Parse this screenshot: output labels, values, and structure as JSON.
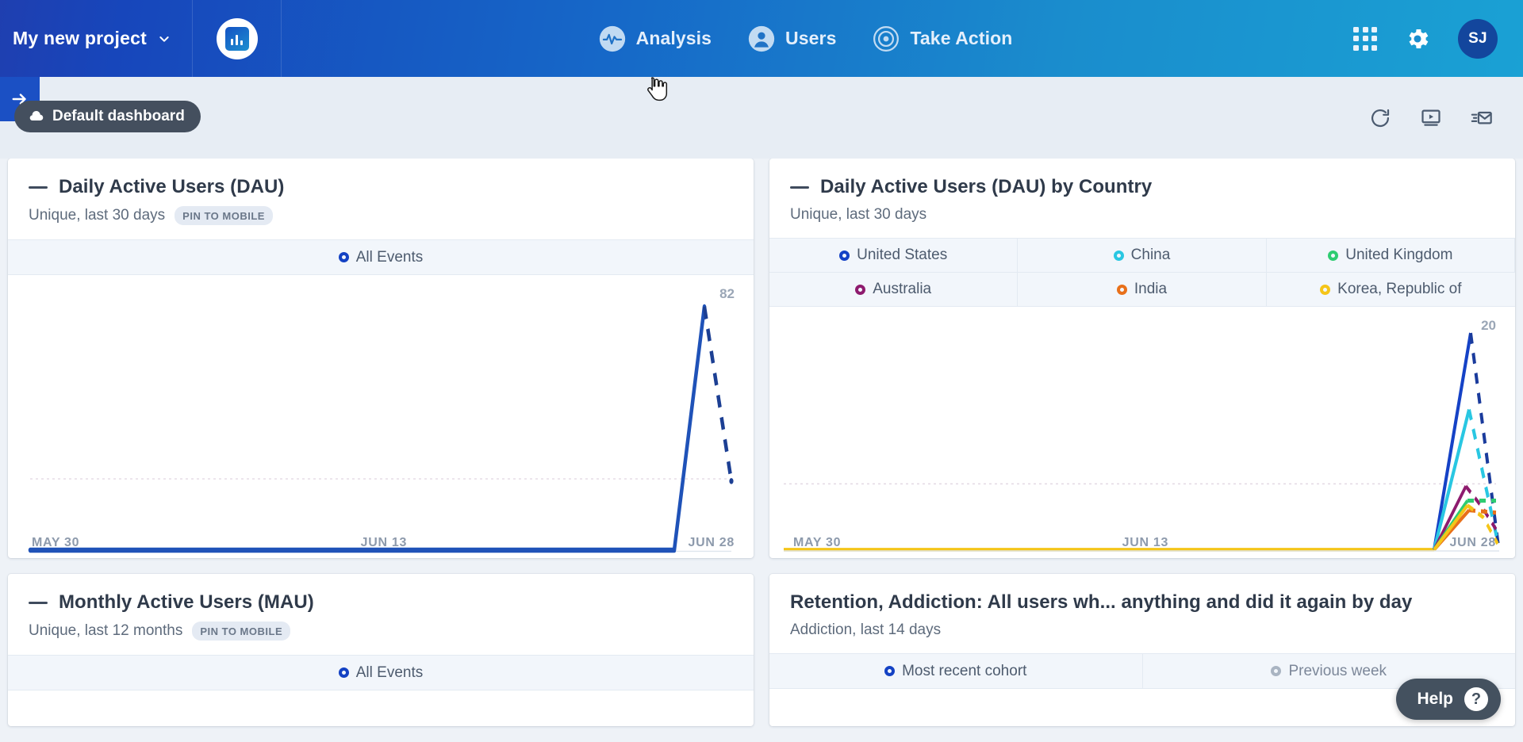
{
  "topnav": {
    "project_name": "My new project",
    "project_chevron_icon": "chevron-down-icon",
    "logo_icon": "bar-chart-logo-icon",
    "items": [
      {
        "label": "Analysis",
        "icon": "analysis-pulse-icon"
      },
      {
        "label": "Users",
        "icon": "user-circle-icon"
      },
      {
        "label": "Take Action",
        "icon": "target-icon"
      }
    ],
    "apps_icon": "apps-grid-icon",
    "settings_icon": "gear-icon",
    "avatar_initials": "SJ",
    "colors": {
      "gradient_start": "#1f3fb0",
      "gradient_end": "#1aa1d4",
      "avatar_bg": "#13469d"
    }
  },
  "subbar": {
    "sidebar_toggle_icon": "arrow-right-icon",
    "dashboard_label": "Default dashboard",
    "dashboard_icon": "cloud-upload-icon",
    "actions": [
      {
        "name": "refresh",
        "icon": "refresh-icon"
      },
      {
        "name": "present",
        "icon": "present-play-icon"
      },
      {
        "name": "email",
        "icon": "email-send-icon"
      }
    ],
    "colors": {
      "toggle_bg": "#1b50c4",
      "pill_bg": "#444f5e",
      "bar_bg": "#e7edf4"
    }
  },
  "cards": [
    {
      "title": "Daily Active Users (DAU)",
      "subtitle": "Unique, last 30 days",
      "pin_badge": "PIN TO MOBILE",
      "has_dash_mark": true,
      "legend": [
        {
          "label": "All Events",
          "color": "#1442c4"
        }
      ]
    },
    {
      "title": "Daily Active Users (DAU) by Country",
      "subtitle": "Unique, last 30 days",
      "pin_badge": "",
      "has_dash_mark": true,
      "legend": [
        {
          "label": "United States",
          "color": "#1542c6"
        },
        {
          "label": "China",
          "color": "#29c7e2"
        },
        {
          "label": "United Kingdom",
          "color": "#2ecc71"
        },
        {
          "label": "Australia",
          "color": "#8e1b6e"
        },
        {
          "label": "India",
          "color": "#e8701a"
        },
        {
          "label": "Korea, Republic of",
          "color": "#f5c518"
        }
      ]
    },
    {
      "title": "Monthly Active Users (MAU)",
      "subtitle": "Unique, last 12 months",
      "pin_badge": "PIN TO MOBILE",
      "has_dash_mark": true,
      "legend": [
        {
          "label": "All Events",
          "color": "#1442c4"
        }
      ]
    },
    {
      "title": "Retention, Addiction: All users wh... anything and did it again by day",
      "subtitle": "Addiction, last 14 days",
      "pin_badge": "",
      "has_dash_mark": false,
      "legend": [
        {
          "label": "Most recent cohort",
          "color": "#1442c4"
        },
        {
          "label": "Previous week",
          "color": "#a9b4c2"
        }
      ]
    }
  ],
  "chart_data": [
    {
      "id": "dau",
      "type": "line",
      "title": "Daily Active Users (DAU)",
      "xlabel": "",
      "ylabel": "",
      "ymax_label": "82",
      "ylim": [
        0,
        82
      ],
      "grid": false,
      "dashed_tail": true,
      "legend_position": "top",
      "xtick_labels": [
        "MAY 30",
        "JUN 13",
        "JUN 28"
      ],
      "series": [
        {
          "name": "All Events",
          "color": "#1442c4",
          "x": [
            "MAY 30",
            "JUN 1",
            "JUN 3",
            "JUN 5",
            "JUN 7",
            "JUN 9",
            "JUN 11",
            "JUN 13",
            "JUN 15",
            "JUN 17",
            "JUN 19",
            "JUN 21",
            "JUN 23",
            "JUN 25",
            "JUN 26",
            "JUN 27",
            "JUN 28"
          ],
          "values": [
            0,
            0,
            0,
            0,
            0,
            0,
            0,
            0,
            0,
            0,
            0,
            0,
            0,
            0,
            0,
            82,
            24
          ]
        }
      ]
    },
    {
      "id": "dau_by_country",
      "type": "line",
      "title": "Daily Active Users (DAU) by Country",
      "xlabel": "",
      "ylabel": "",
      "ymax_label": "20",
      "ylim": [
        0,
        20
      ],
      "grid": false,
      "dashed_tail": true,
      "legend_position": "top",
      "xtick_labels": [
        "MAY 30",
        "JUN 13",
        "JUN 28"
      ],
      "series": [
        {
          "name": "United States",
          "color": "#1542c6",
          "values": [
            0,
            0,
            0,
            0,
            0,
            0,
            0,
            0,
            0,
            0,
            0,
            0,
            0,
            0,
            0,
            20,
            0
          ]
        },
        {
          "name": "China",
          "color": "#29c7e2",
          "values": [
            0,
            0,
            0,
            0,
            0,
            0,
            0,
            0,
            0,
            0,
            0,
            0,
            0,
            0,
            0,
            13,
            1
          ]
        },
        {
          "name": "United Kingdom",
          "color": "#2ecc71",
          "values": [
            0,
            0,
            0,
            0,
            0,
            0,
            0,
            0,
            0,
            0,
            0,
            0,
            0,
            0,
            0,
            4,
            4
          ]
        },
        {
          "name": "Australia",
          "color": "#8e1b6e",
          "values": [
            0,
            0,
            0,
            0,
            0,
            0,
            0,
            0,
            0,
            0,
            0,
            0,
            0,
            0,
            0,
            5,
            2
          ]
        },
        {
          "name": "India",
          "color": "#e8701a",
          "values": [
            0,
            0,
            0,
            0,
            0,
            0,
            0,
            0,
            0,
            0,
            0,
            0,
            0,
            0,
            0,
            3,
            3
          ]
        },
        {
          "name": "Korea, Republic of",
          "color": "#f5c518",
          "values": [
            0,
            0,
            0,
            0,
            0,
            0,
            0,
            0,
            0,
            0,
            0,
            0,
            0,
            0,
            0,
            4,
            1
          ]
        }
      ]
    }
  ],
  "help": {
    "label": "Help",
    "icon": "question-mark-icon"
  },
  "cursor": {
    "icon": "pointer-hand-cursor"
  }
}
